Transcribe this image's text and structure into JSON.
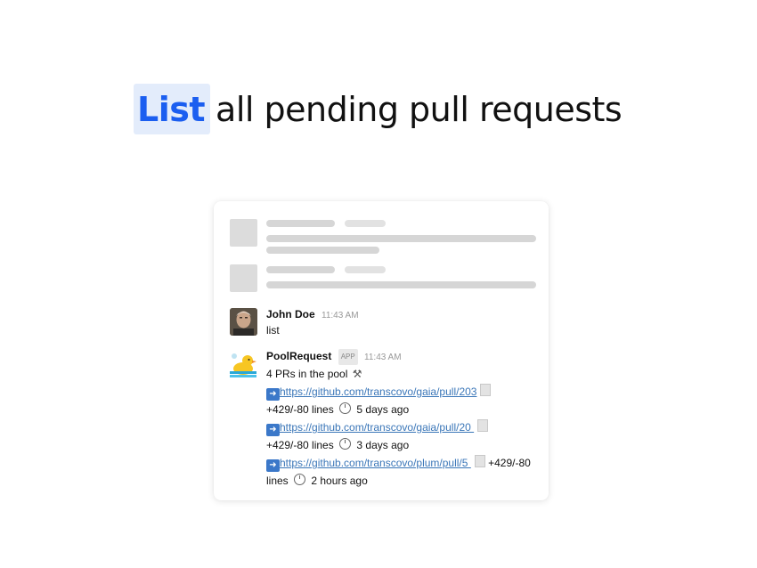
{
  "headline": {
    "highlight": "List",
    "rest": "all pending pull requests"
  },
  "colors": {
    "accent": "#1b5ef0",
    "highlight_bg": "#e3ecfb",
    "link": "#3a76b8"
  },
  "messages": [
    {
      "author": "John Doe",
      "time": "11:43 AM",
      "text": "list",
      "avatar": "user-photo"
    },
    {
      "author": "PoolRequest",
      "badge": "APP",
      "time": "11:43 AM",
      "avatar": "duck-icon",
      "summary": "4 PRs in the pool",
      "prs": [
        {
          "url": "https://github.com/transcovo/gaia/pull/203",
          "lines": "+429/-80 lines",
          "age": "5 days ago"
        },
        {
          "url": "https://github.com/transcovo/gaia/pull/20 ",
          "lines": "+429/-80 lines",
          "age": "3 days ago"
        },
        {
          "url": "https://github.com/transcovo/plum/pull/5 ",
          "lines_a": "+429/-80",
          "lines_b": "lines",
          "age": "2 hours ago"
        }
      ]
    }
  ]
}
